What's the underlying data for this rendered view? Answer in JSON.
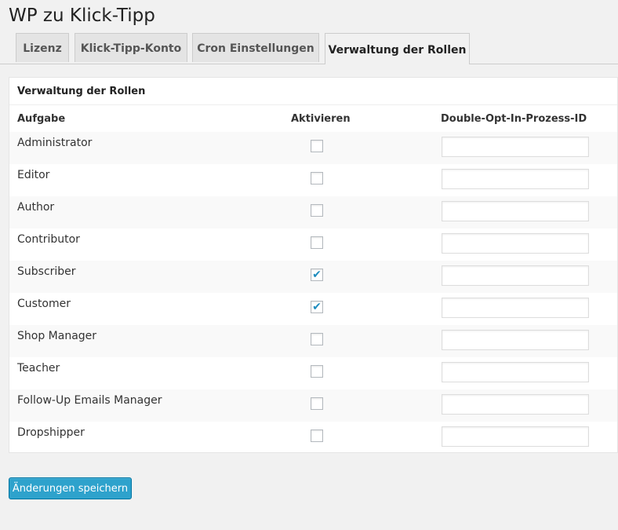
{
  "page": {
    "title": "WP zu Klick-Tipp"
  },
  "tabs": [
    {
      "label": "Lizenz",
      "active": false
    },
    {
      "label": "Klick-Tipp-Konto",
      "active": false
    },
    {
      "label": "Cron Einstellungen",
      "active": false
    },
    {
      "label": "Verwaltung der Rollen",
      "active": true
    }
  ],
  "panel": {
    "title": "Verwaltung der Rollen",
    "columns": {
      "task": "Aufgabe",
      "activate": "Aktivieren",
      "doi": "Double-Opt-In-Prozess-ID"
    },
    "rows": [
      {
        "role": "Administrator",
        "checked": false,
        "doi_value": ""
      },
      {
        "role": "Editor",
        "checked": false,
        "doi_value": ""
      },
      {
        "role": "Author",
        "checked": false,
        "doi_value": ""
      },
      {
        "role": "Contributor",
        "checked": false,
        "doi_value": ""
      },
      {
        "role": "Subscriber",
        "checked": true,
        "doi_value": ""
      },
      {
        "role": "Customer",
        "checked": true,
        "doi_value": ""
      },
      {
        "role": "Shop Manager",
        "checked": false,
        "doi_value": ""
      },
      {
        "role": "Teacher",
        "checked": false,
        "doi_value": ""
      },
      {
        "role": "Follow-Up Emails Manager",
        "checked": false,
        "doi_value": ""
      },
      {
        "role": "Dropshipper",
        "checked": false,
        "doi_value": ""
      }
    ]
  },
  "actions": {
    "save_label": "Änderungen speichern"
  },
  "colors": {
    "accent": "#2ea2cc",
    "check": "#1e8cbe"
  }
}
